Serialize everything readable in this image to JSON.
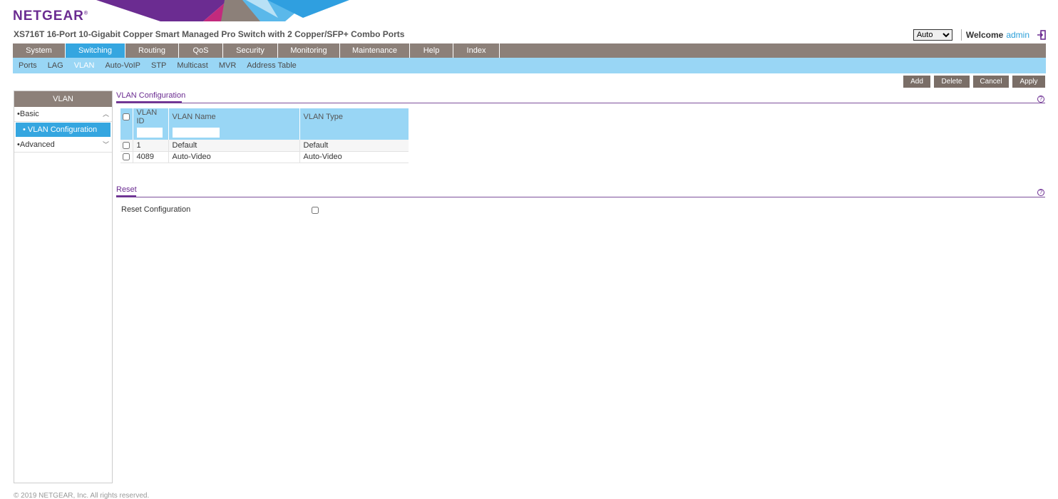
{
  "brand": {
    "logo": "NETGEAR",
    "reg": "®"
  },
  "header": {
    "product_title": "XS716T 16-Port 10-Gigabit Copper Smart Managed Pro Switch with 2 Copper/SFP+ Combo Ports",
    "language_selected": "Auto",
    "welcome": "Welcome",
    "user": "admin"
  },
  "topnav": [
    {
      "label": "System",
      "active": false
    },
    {
      "label": "Switching",
      "active": true
    },
    {
      "label": "Routing",
      "active": false
    },
    {
      "label": "QoS",
      "active": false
    },
    {
      "label": "Security",
      "active": false
    },
    {
      "label": "Monitoring",
      "active": false
    },
    {
      "label": "Maintenance",
      "active": false
    },
    {
      "label": "Help",
      "active": false
    },
    {
      "label": "Index",
      "active": false
    }
  ],
  "subnav": [
    {
      "label": "Ports",
      "active": false
    },
    {
      "label": "LAG",
      "active": false
    },
    {
      "label": "VLAN",
      "active": true
    },
    {
      "label": "Auto-VoIP",
      "active": false
    },
    {
      "label": "STP",
      "active": false
    },
    {
      "label": "Multicast",
      "active": false
    },
    {
      "label": "MVR",
      "active": false
    },
    {
      "label": "Address Table",
      "active": false
    }
  ],
  "actions": {
    "add": "Add",
    "delete": "Delete",
    "cancel": "Cancel",
    "apply": "Apply"
  },
  "sidebar": {
    "title": "VLAN",
    "basic": "Basic",
    "vlan_configuration": "VLAN Configuration",
    "advanced": "Advanced"
  },
  "vlan_config": {
    "title": "VLAN Configuration",
    "columns": {
      "id": "VLAN ID",
      "name": "VLAN Name",
      "type": "VLAN Type"
    },
    "filter": {
      "id": "",
      "name": ""
    },
    "rows": [
      {
        "id": "1",
        "name": "Default",
        "type": "Default"
      },
      {
        "id": "4089",
        "name": "Auto-Video",
        "type": "Auto-Video"
      }
    ]
  },
  "reset": {
    "title": "Reset",
    "label": "Reset Configuration"
  },
  "footer": "© 2019 NETGEAR, Inc. All rights reserved.",
  "colors": {
    "brand_purple": "#6b2c91",
    "nav_gray": "#8c8079",
    "active_blue": "#35a6e0",
    "light_blue": "#99d6f5",
    "button_gray": "#7a6e67"
  }
}
